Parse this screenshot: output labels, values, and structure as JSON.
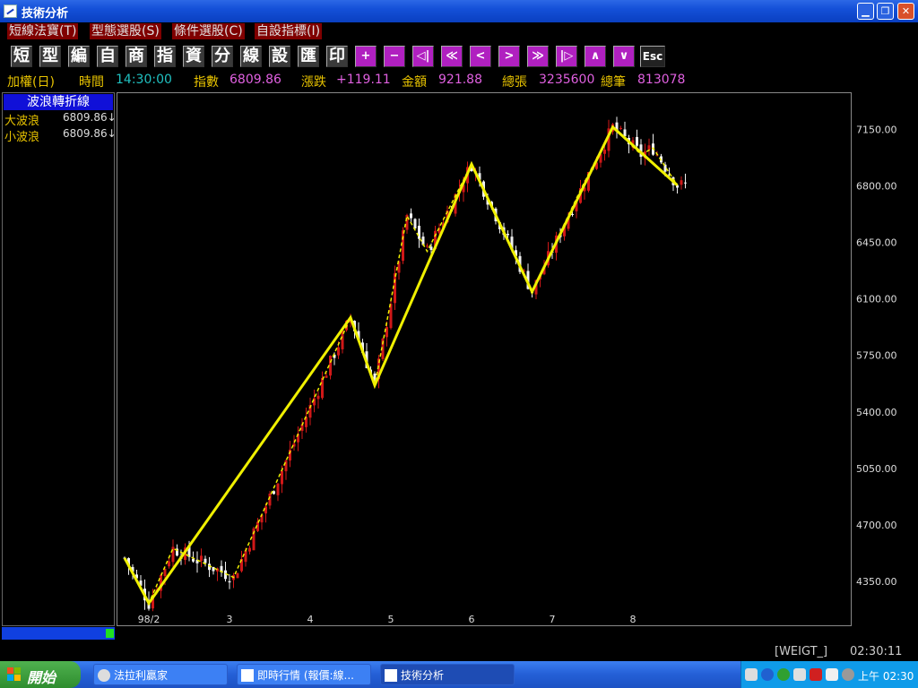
{
  "window": {
    "title": "技術分析"
  },
  "menu": [
    "短線法寶(T)",
    "型態選股(S)",
    "條件選股(C)",
    "自設指標(I)"
  ],
  "toolbar": {
    "buttons": [
      "短",
      "型",
      "編",
      "自",
      "商",
      "指",
      "資",
      "分",
      "線",
      "設",
      "匯",
      "印"
    ],
    "nav": [
      "+",
      "−",
      "◁|",
      "≪",
      "<",
      ">",
      "≫",
      "|▷",
      "∧",
      "∨"
    ],
    "esc": "Esc"
  },
  "info": {
    "symbol": "加權(日)",
    "time_label": "時間",
    "time_value": "14:30:00",
    "index_label": "指數",
    "index_value": "6809.86",
    "change_label": "漲跌",
    "change_value": "+119.11",
    "amount_label": "金額",
    "amount_value": "921.88",
    "volume_label": "總張",
    "volume_value": "3235600",
    "trades_label": "總筆",
    "trades_value": "813078"
  },
  "panel": {
    "header": "波浪轉折線",
    "rows": [
      {
        "label": "大波浪",
        "value": "6809.86↓"
      },
      {
        "label": "小波浪",
        "value": "6809.86↓"
      }
    ]
  },
  "status": {
    "code": "[WEIGT_]",
    "time": "02:30:11"
  },
  "taskbar": {
    "start": "開始",
    "tasks": [
      "法拉利贏家",
      "即時行情 (報價:線...",
      "技術分析"
    ],
    "clock": "上午 02:30"
  },
  "colors": {
    "up": "#d01818",
    "down": "#f0f0f0",
    "wave": "#f0f000",
    "panel_header": "#1010d8"
  },
  "chart_data": {
    "type": "candlestick",
    "ylim": [
      4150,
      7380
    ],
    "yticks": [
      4350,
      4700,
      5050,
      5400,
      5750,
      6100,
      6450,
      6800,
      7150
    ],
    "ytick_labels": [
      "4350.00",
      "4700.00",
      "5050.00",
      "5400.00",
      "5750.00",
      "6100.00",
      "6450.00",
      "6800.00",
      "7150.00"
    ],
    "xtick_labels": [
      "98/2",
      "3",
      "4",
      "5",
      "6",
      "7",
      "8"
    ],
    "xtick_index": [
      6,
      26,
      46,
      66,
      86,
      106,
      126
    ],
    "n_bars": 140,
    "big_wave": [
      [
        0,
        4500
      ],
      [
        6,
        4220
      ],
      [
        56,
        5990
      ],
      [
        62,
        5570
      ],
      [
        86,
        6940
      ],
      [
        101,
        6150
      ],
      [
        121,
        7170
      ],
      [
        137,
        6810
      ]
    ],
    "small_wave": [
      [
        0,
        4500
      ],
      [
        6,
        4220
      ],
      [
        12,
        4560
      ],
      [
        27,
        4380
      ],
      [
        56,
        5990
      ],
      [
        62,
        5570
      ],
      [
        70,
        6620
      ],
      [
        75,
        6400
      ],
      [
        86,
        6940
      ],
      [
        101,
        6150
      ],
      [
        113,
        6780
      ],
      [
        121,
        7170
      ],
      [
        128,
        7000
      ],
      [
        131,
        7040
      ],
      [
        137,
        6810
      ]
    ]
  }
}
